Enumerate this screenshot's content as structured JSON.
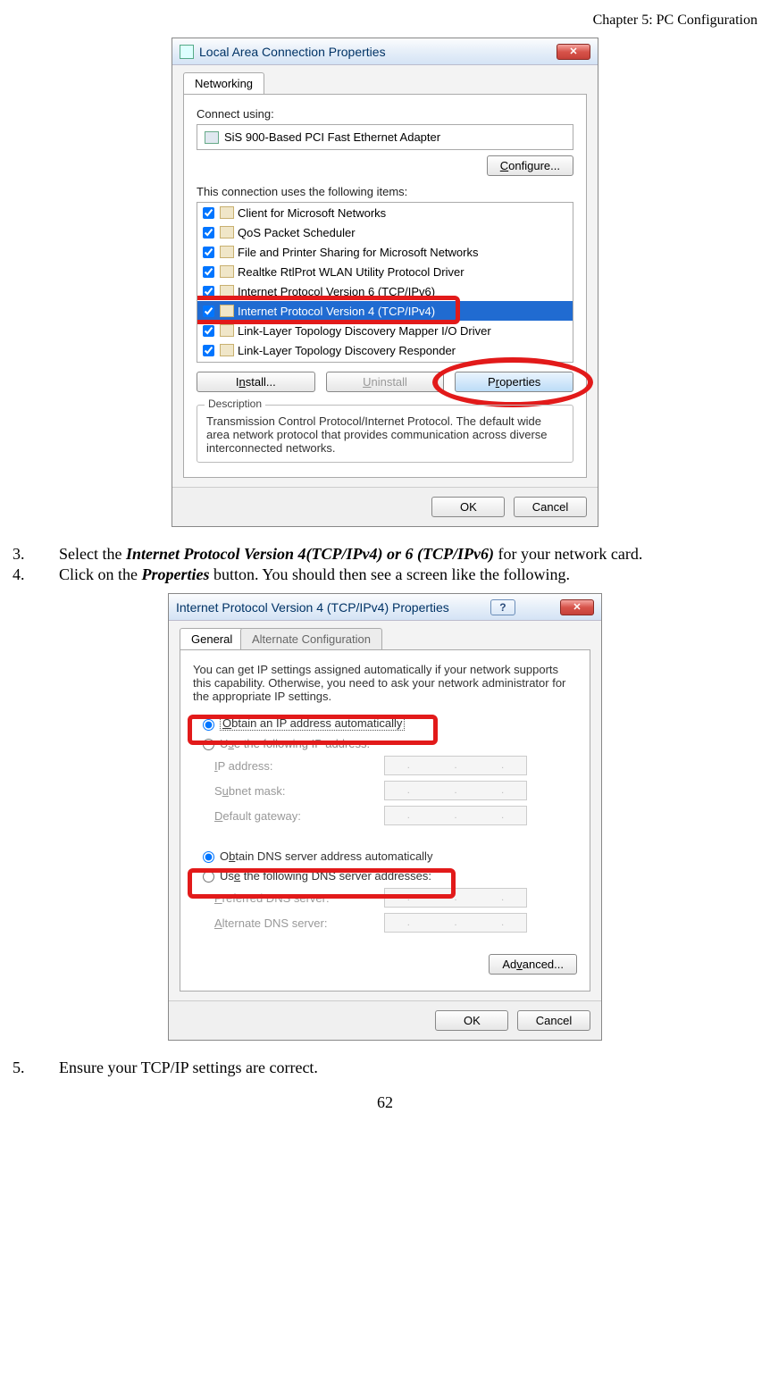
{
  "doc": {
    "chapter_header": "Chapter 5: PC Configuration",
    "page_number": "62",
    "step3_num": "3.",
    "step3_a": "Select the ",
    "step3_b": "Internet Protocol Version 4(TCP/IPv4) or 6 (TCP/IPv6)",
    "step3_c": " for your network card.",
    "step4_num": "4.",
    "step4_a": "Click on the ",
    "step4_b": "Properties",
    "step4_c": " button. You should then see a screen like the following.",
    "step5_num": "5.",
    "step5_text": "Ensure your TCP/IP settings are correct."
  },
  "win1": {
    "title": "Local Area Connection Properties",
    "close_glyph": "✕",
    "tab": "Networking",
    "connect_using_label": "Connect using:",
    "adapter_name": "SiS 900-Based PCI Fast Ethernet Adapter",
    "configure_btn": "Configure...",
    "items_label": "This connection uses the following items:",
    "items": [
      "Client for Microsoft Networks",
      "QoS Packet Scheduler",
      "File and Printer Sharing for Microsoft Networks",
      "Realtke RtlProt WLAN Utility Protocol Driver",
      "Internet Protocol Version 6 (TCP/IPv6)",
      "Internet Protocol Version 4 (TCP/IPv4)",
      "Link-Layer Topology Discovery Mapper I/O Driver",
      "Link-Layer Topology Discovery Responder"
    ],
    "install_btn": "Install...",
    "uninstall_btn": "Uninstall",
    "properties_btn": "Properties",
    "desc_legend": "Description",
    "desc_text": "Transmission Control Protocol/Internet Protocol. The default wide area network protocol that provides communication across diverse interconnected networks.",
    "ok_btn": "OK",
    "cancel_btn": "Cancel"
  },
  "win2": {
    "title": "Internet Protocol Version 4 (TCP/IPv4) Properties",
    "help_glyph": "?",
    "close_glyph": "✕",
    "tab_general": "General",
    "tab_alt": "Alternate Configuration",
    "intro": "You can get IP settings assigned automatically if your network supports this capability. Otherwise, you need to ask your network administrator for the appropriate IP settings.",
    "radio_ip_auto": "Obtain an IP address automatically",
    "radio_ip_manual": "Use the following IP address:",
    "ip_label": "IP address:",
    "subnet_label": "Subnet mask:",
    "gateway_label": "Default gateway:",
    "radio_dns_auto": "Obtain DNS server address automatically",
    "radio_dns_manual": "Use the following DNS server addresses:",
    "pref_dns_label": "Preferred DNS server:",
    "alt_dns_label": "Alternate DNS server:",
    "advanced_btn": "Advanced...",
    "ok_btn": "OK",
    "cancel_btn": "Cancel"
  }
}
